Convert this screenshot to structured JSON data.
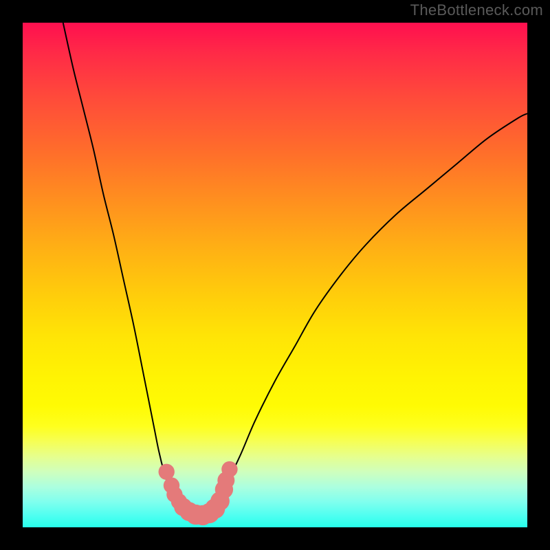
{
  "watermark": "TheBottleneck.com",
  "colors": {
    "frame": "#000000",
    "curve": "#000000",
    "marker": "#e47a7a",
    "gradient_top": "#ff0f4f",
    "gradient_bottom": "#27ffea"
  },
  "chart_data": {
    "type": "line",
    "title": "",
    "xlabel": "",
    "ylabel": "",
    "xlim": [
      0,
      100
    ],
    "ylim": [
      0,
      100
    ],
    "description": "Two black curves descending from opposite sides into a V-shaped minimum near x≈32–40, over a vertical red→green gradient background. Pink rounded markers sit at the bottom of the V.",
    "series": [
      {
        "name": "left-curve",
        "x": [
          8,
          10,
          12,
          14,
          16,
          18,
          20,
          22,
          24,
          26,
          27,
          28,
          29,
          30,
          31,
          32
        ],
        "y": [
          100,
          91,
          83,
          75,
          66,
          58,
          49,
          40,
          30,
          20,
          15,
          11,
          8,
          7,
          6,
          5
        ]
      },
      {
        "name": "right-curve",
        "x": [
          38,
          40,
          43,
          46,
          50,
          54,
          58,
          63,
          68,
          74,
          80,
          86,
          92,
          98,
          100
        ],
        "y": [
          5,
          8,
          14,
          21,
          29,
          36,
          43,
          50,
          56,
          62,
          67,
          72,
          77,
          81,
          82
        ]
      }
    ],
    "markers": {
      "name": "min-markers",
      "points": [
        {
          "x": 28.5,
          "y": 11.0,
          "r": 1.6
        },
        {
          "x": 29.5,
          "y": 8.3,
          "r": 1.6
        },
        {
          "x": 30.1,
          "y": 6.5,
          "r": 1.6
        },
        {
          "x": 31.0,
          "y": 5.1,
          "r": 1.6
        },
        {
          "x": 31.8,
          "y": 4.0,
          "r": 1.8
        },
        {
          "x": 33.0,
          "y": 3.1,
          "r": 1.9
        },
        {
          "x": 34.3,
          "y": 2.5,
          "r": 2.0
        },
        {
          "x": 35.7,
          "y": 2.4,
          "r": 2.0
        },
        {
          "x": 37.0,
          "y": 2.8,
          "r": 2.0
        },
        {
          "x": 38.1,
          "y": 3.7,
          "r": 2.0
        },
        {
          "x": 39.1,
          "y": 5.2,
          "r": 1.9
        },
        {
          "x": 39.9,
          "y": 7.5,
          "r": 1.8
        },
        {
          "x": 40.3,
          "y": 9.3,
          "r": 1.7
        },
        {
          "x": 41.0,
          "y": 11.5,
          "r": 1.6
        }
      ]
    }
  }
}
